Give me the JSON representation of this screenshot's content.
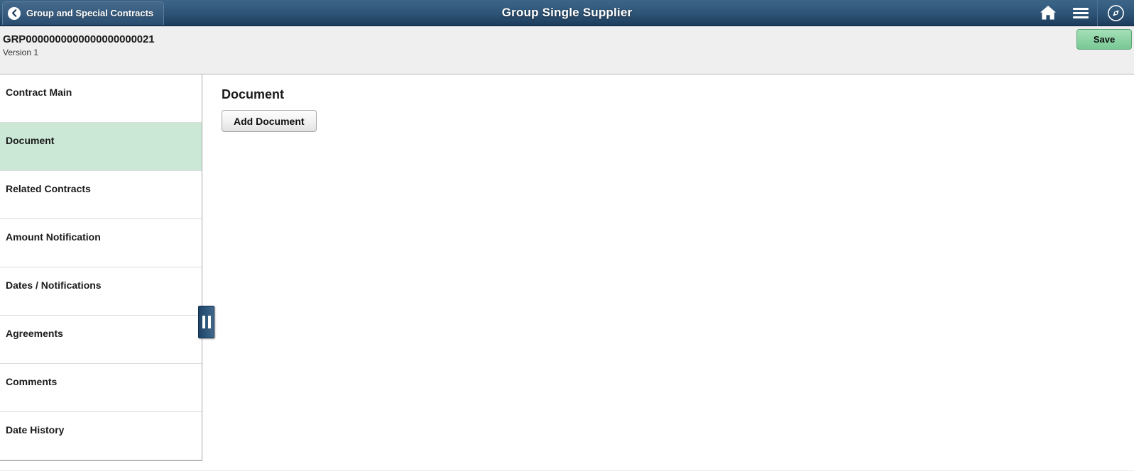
{
  "header": {
    "back_button_label": "Group and Special Contracts",
    "back_icon": "chevron-left-icon",
    "title": "Group Single Supplier",
    "icons": [
      {
        "name": "home-icon",
        "label": "Home"
      },
      {
        "name": "hamburger-menu-icon",
        "label": "Actions List"
      },
      {
        "name": "navbar-compass-icon",
        "label": "NavBar"
      }
    ]
  },
  "subheader": {
    "document_id": "GRP0000000000000000000021",
    "version": "Version 1",
    "save_label": "Save"
  },
  "sidebar": {
    "collapse_handle_name": "sidebar-collapse-handle",
    "items": [
      {
        "label": "Contract Main",
        "active": false
      },
      {
        "label": "Document",
        "active": true
      },
      {
        "label": "Related Contracts",
        "active": false
      },
      {
        "label": "Amount Notification",
        "active": false
      },
      {
        "label": "Dates / Notifications",
        "active": false
      },
      {
        "label": "Agreements",
        "active": false
      },
      {
        "label": "Comments",
        "active": false
      },
      {
        "label": "Date History",
        "active": false
      }
    ]
  },
  "main": {
    "title": "Document",
    "add_document_label": "Add Document"
  },
  "colors": {
    "header_top": "#3c6485",
    "header_bottom": "#1c3c5c",
    "subheader_bg": "#efefef",
    "active_item_bg": "#cbe8d7",
    "save_button_bg": "#8ed4a6",
    "handle_bg": "#2e587c"
  }
}
